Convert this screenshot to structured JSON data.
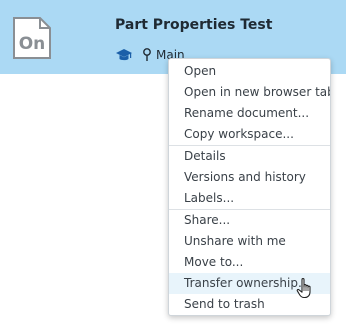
{
  "document": {
    "title": "Part Properties Test",
    "branch": "Main",
    "thumbnail_text": "On"
  },
  "context_menu": {
    "items": [
      {
        "label": "Open"
      },
      {
        "label": "Open in new browser tab"
      },
      {
        "label": "Rename document..."
      },
      {
        "label": "Copy workspace..."
      },
      {
        "label": "Details"
      },
      {
        "label": "Versions and history"
      },
      {
        "label": "Labels..."
      },
      {
        "label": "Share..."
      },
      {
        "label": "Unshare with me"
      },
      {
        "label": "Move to..."
      },
      {
        "label": "Transfer ownership...",
        "highlighted": true
      },
      {
        "label": "Send to trash"
      }
    ]
  },
  "colors": {
    "row_selected": "#abd9f4",
    "menu_hover": "#e8f4fb",
    "icon_blue": "#1b5fa8"
  }
}
